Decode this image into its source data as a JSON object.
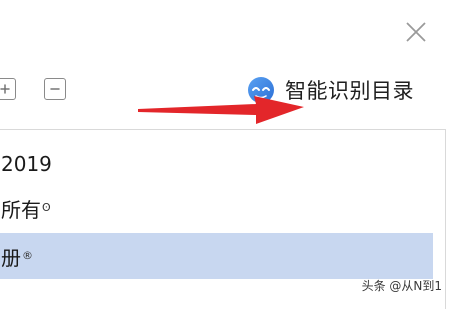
{
  "header": {
    "close_icon": "close-icon"
  },
  "toolbar": {
    "expand_icon": "plus-box-icon",
    "collapse_icon": "minus-box-icon",
    "smart_button": {
      "icon": "smart-face-icon",
      "label": "智能识别目录",
      "accent_color": "#3d86e0"
    }
  },
  "annotation": {
    "arrow_color": "#e3262a"
  },
  "tree": {
    "items": [
      {
        "label": "2019",
        "suffix": ""
      },
      {
        "label": "所有",
        "suffix": "ʘ"
      },
      {
        "label": "册",
        "suffix": "®",
        "selected": true
      }
    ],
    "selected_color": "#c8d7f0"
  },
  "watermark": {
    "text": "头条 @从N到1"
  }
}
